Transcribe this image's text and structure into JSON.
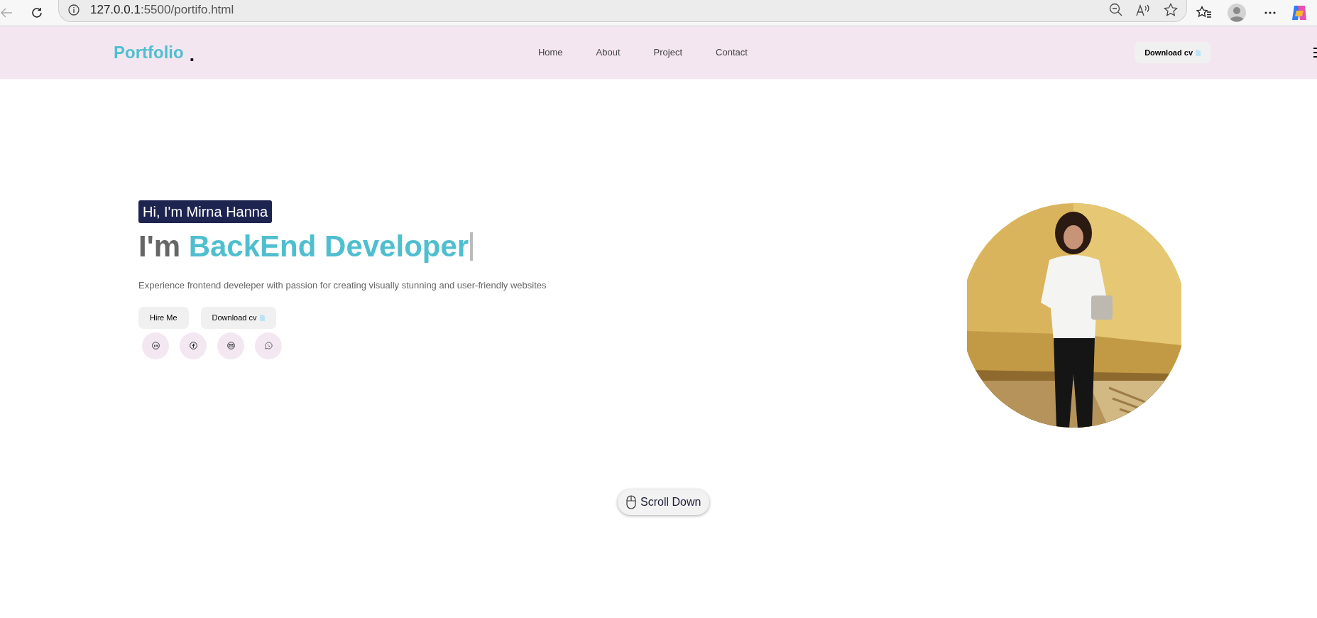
{
  "browser": {
    "url_host": "127.0.0.1",
    "url_path": ":5500/portifo.html"
  },
  "nav": {
    "logo": "Portfolio",
    "logo_dot": ".",
    "links": [
      {
        "label": "Home"
      },
      {
        "label": "About"
      },
      {
        "label": "Project"
      },
      {
        "label": "Contact"
      }
    ],
    "cta": "Download cv"
  },
  "hero": {
    "badge": "Hi, I'm Mirna Hanna",
    "heading_prefix": "I'm",
    "heading_highlight": "BackEnd Developer",
    "text": "Experience frontend develeper with passion for creating visually stunning and user-friendly websites",
    "buttons": [
      {
        "label": "Hire Me",
        "kind": "plain"
      },
      {
        "label": "Download cv",
        "kind": "file"
      }
    ],
    "socials": [
      {
        "kind": "linkedin"
      },
      {
        "kind": "facebook"
      },
      {
        "kind": "mail"
      },
      {
        "kind": "whatsapp"
      }
    ]
  },
  "scroll": {
    "label": "Scroll Down"
  }
}
